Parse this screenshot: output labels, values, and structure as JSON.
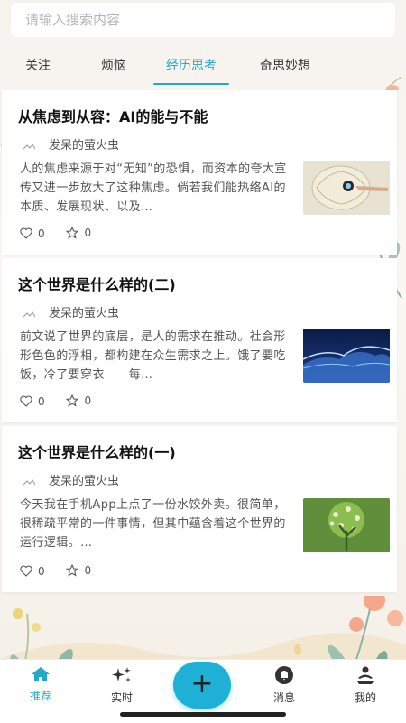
{
  "search": {
    "placeholder": "请输入搜索内容"
  },
  "tabs": [
    {
      "label": "关注"
    },
    {
      "label": "烦恼"
    },
    {
      "label": "经历思考"
    },
    {
      "label": "奇思妙想"
    }
  ],
  "active_tab": "经历思考",
  "articles": [
    {
      "title": "从焦虑到从容：AI的能与不能",
      "author": "发呆的萤火虫",
      "excerpt": "人的焦虑来源于对“无知”的恐惧，而资本的夸大宣传又进一步放大了这种焦虑。倘若我们能热络AI的本质、发展现状、以及…",
      "likes": "0",
      "favorites": "0",
      "thumbnail": "brain-circuit-image"
    },
    {
      "title": "这个世界是什么样的(二)",
      "author": "发呆的萤火虫",
      "excerpt": "前文说了世界的底层，是人的需求在推动。社会形形色色的浮相，都构建在众生需求之上。饿了要吃饭，冷了要穿衣——每…",
      "likes": "0",
      "favorites": "0",
      "thumbnail": "blue-wave-image"
    },
    {
      "title": "这个世界是什么样的(一)",
      "author": "发呆的萤火虫",
      "excerpt": "今天我在手机App上点了一份水饺外卖。很简单，很稀疏平常的一件事情，但其中蕴含着这个世界的运行逻辑。…",
      "likes": "0",
      "favorites": "0",
      "thumbnail": "tree-image"
    }
  ],
  "nav": [
    {
      "label": "推荐",
      "icon": "home-icon"
    },
    {
      "label": "实时",
      "icon": "sparkle-icon"
    },
    {
      "label": "+",
      "icon": "plus-icon"
    },
    {
      "label": "消息",
      "icon": "bell-icon"
    },
    {
      "label": "我的",
      "icon": "user-icon"
    }
  ],
  "colors": {
    "accent": "#23a9c8",
    "fab": "#1fb0d6"
  }
}
